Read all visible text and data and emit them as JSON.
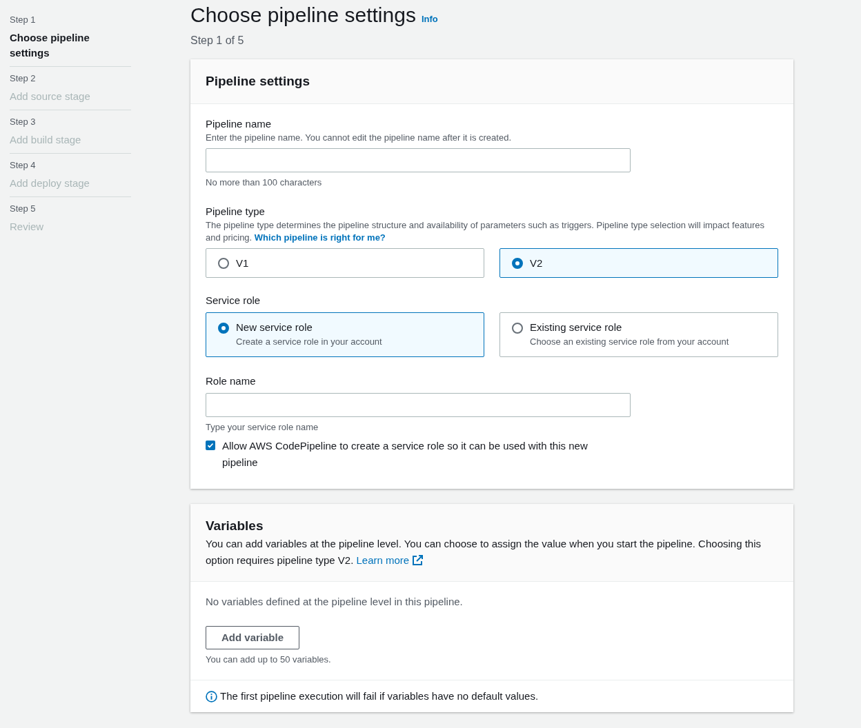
{
  "steps": [
    {
      "step": "Step 1",
      "title": "Choose pipeline settings",
      "selected": true
    },
    {
      "step": "Step 2",
      "title": "Add source stage",
      "selected": false
    },
    {
      "step": "Step 3",
      "title": "Add build stage",
      "selected": false
    },
    {
      "step": "Step 4",
      "title": "Add deploy stage",
      "selected": false
    },
    {
      "step": "Step 5",
      "title": "Review",
      "selected": false
    }
  ],
  "page": {
    "title": "Choose pipeline settings",
    "info": "Info",
    "subtitle": "Step 1 of 5"
  },
  "pipeline_settings": {
    "heading": "Pipeline settings",
    "name_field": {
      "label": "Pipeline name",
      "description": "Enter the pipeline name. You cannot edit the pipeline name after it is created.",
      "constraint": "No more than 100 characters"
    },
    "pipeline_type": {
      "label": "Pipeline type",
      "description": "The pipeline type determines the pipeline structure and availability of parameters such as triggers. Pipeline type selection will impact features and pricing.",
      "link": "Which pipeline is right for me?",
      "options": [
        {
          "label": "V1",
          "selected": false
        },
        {
          "label": "V2",
          "selected": true
        }
      ]
    },
    "service_role": {
      "label": "Service role",
      "options": [
        {
          "label": "New service role",
          "description": "Create a service role in your account",
          "selected": true
        },
        {
          "label": "Existing service role",
          "description": "Choose an existing service role from your account",
          "selected": false
        }
      ]
    },
    "role_name": {
      "label": "Role name",
      "constraint": "Type your service role name"
    },
    "allow_checkbox": {
      "label": "Allow AWS CodePipeline to create a service role so it can be used with this new pipeline",
      "checked": true
    }
  },
  "variables": {
    "heading": "Variables",
    "description": "You can add variables at the pipeline level. You can choose to assign the value when you start the pipeline. Choosing this option requires pipeline type V2.",
    "link": "Learn more",
    "empty": "No variables defined at the pipeline level in this pipeline.",
    "button": "Add variable",
    "constraint": "You can add up to 50 variables.",
    "notice": "The first pipeline execution will fail if variables have no default values."
  }
}
